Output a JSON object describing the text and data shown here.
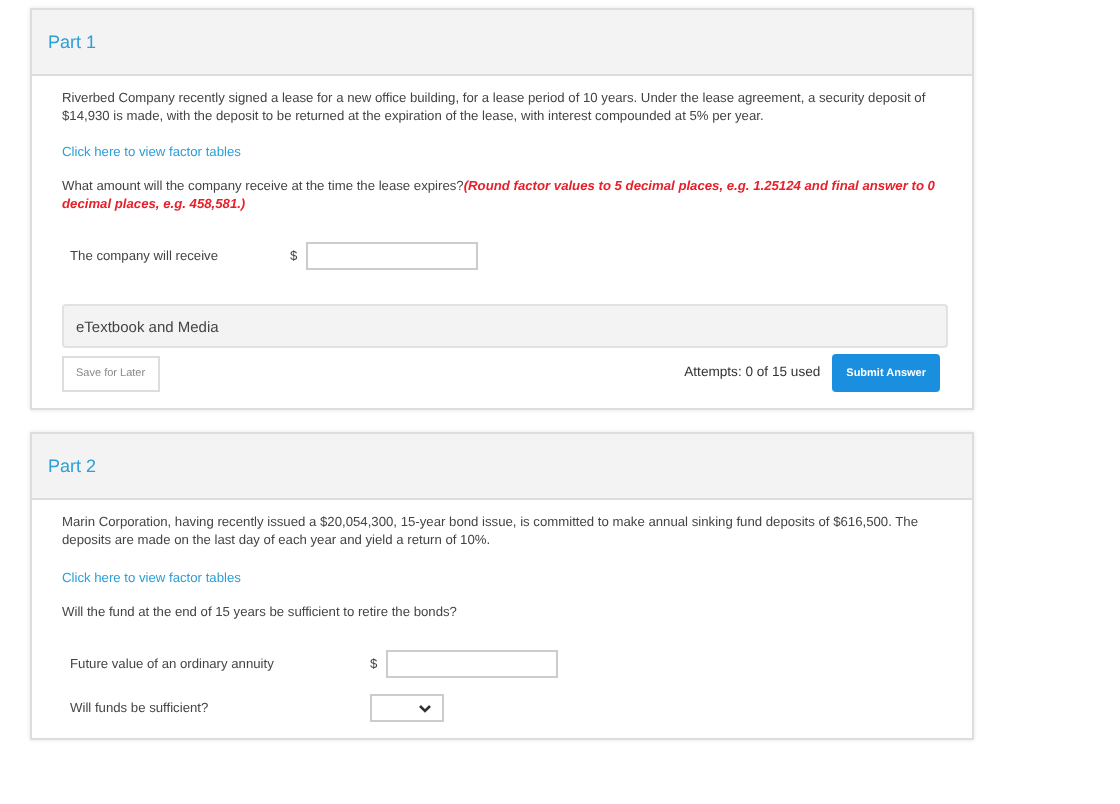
{
  "parts": [
    {
      "title": "Part 1",
      "problem": "Riverbed Company recently signed a lease for a new office building, for a lease period of 10 years. Under the lease agreement, a security deposit of $14,930 is made, with the deposit to be returned at the expiration of the lease, with interest compounded at 5% per year.",
      "link": "Click here to view factor tables",
      "question": "What amount will the company receive at the time the lease expires?",
      "instruction": "(Round factor values to 5 decimal places, e.g. 1.25124 and final answer to 0 decimal places, e.g. 458,581.)",
      "fields": [
        {
          "kind": "amount",
          "label": "The company will receive",
          "prefix": "$"
        }
      ],
      "media": "eTextbook and Media",
      "save": "Save for Later",
      "attempts": "Attempts: 0 of 15 used",
      "submit": "Submit Answer"
    },
    {
      "title": "Part 2",
      "problem": "Marin Corporation, having recently issued a $20,054,300, 15-year bond issue, is committed to make annual sinking fund deposits of $616,500. The deposits are made on the last day of each year and yield a return of 10%.",
      "link": "Click here to view factor tables",
      "question": "Will the fund at the end of 15 years be sufficient to retire the bonds?",
      "fields": [
        {
          "kind": "amount",
          "label": "Future value of an ordinary annuity",
          "prefix": "$"
        },
        {
          "kind": "select",
          "label": "Will funds be sufficient?"
        }
      ]
    }
  ]
}
